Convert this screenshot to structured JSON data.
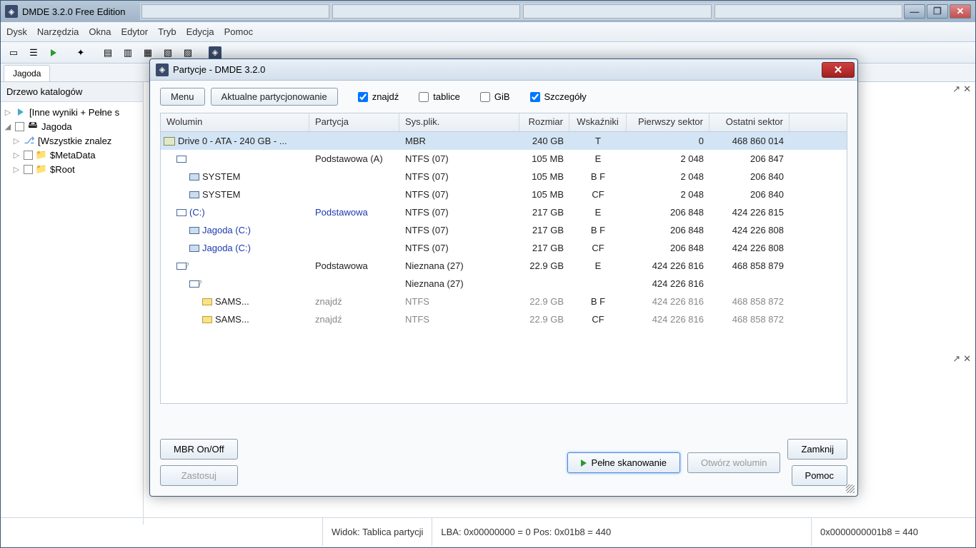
{
  "main_title": "DMDE 3.2.0 Free Edition",
  "menu": [
    "Dysk",
    "Narzędzia",
    "Okna",
    "Edytor",
    "Tryb",
    "Edycja",
    "Pomoc"
  ],
  "doc_tab": "Jagoda",
  "sidebar_title": "Drzewo katalogów",
  "tree": {
    "n0": "[Inne wyniki + Pełne s",
    "n1": "Jagoda",
    "n2": "[Wszystkie znalez",
    "n3": "$MetaData",
    "n4": "$Root"
  },
  "status": {
    "view": "Widok:  Tablica partycji",
    "lba": "LBA: 0x00000000 = 0  Pos: 0x01b8 = 440",
    "offs": "0x0000000001b8 = 440"
  },
  "dlg": {
    "title": "Partycje - DMDE 3.2.0",
    "btn_menu": "Menu",
    "btn_cur": "Aktualne partycjonowanie",
    "chk_find": "znajdź",
    "chk_tables": "tablice",
    "chk_gib": "GiB",
    "chk_details": "Szczegóły",
    "hdr": {
      "vol": "Wolumin",
      "part": "Partycja",
      "fs": "Sys.plik.",
      "size": "Rozmiar",
      "ind": "Wskaźniki",
      "first": "Pierwszy sektor",
      "last": "Ostatni sektor"
    },
    "rows": [
      {
        "vol": "Drive 0 - ATA - 240 GB - ...",
        "part": "",
        "fs": "MBR",
        "size": "240 GB",
        "ind": "T",
        "first": "0",
        "last": "468 860 014",
        "sel": true,
        "indent": 0,
        "ico": "drive",
        "green": true
      },
      {
        "vol": "",
        "part": "Podstawowa (A)",
        "fs": "NTFS (07)",
        "size": "105 MB",
        "ind": "E",
        "first": "2 048",
        "last": "206 847",
        "indent": 1,
        "ico": "vol"
      },
      {
        "vol": "SYSTEM",
        "part": "",
        "fs": "NTFS (07)",
        "size": "105 MB",
        "ind": "B  F",
        "first": "2 048",
        "last": "206 840",
        "indent": 2,
        "ico": "volblue",
        "green": true
      },
      {
        "vol": "SYSTEM",
        "part": "",
        "fs": "NTFS (07)",
        "size": "105 MB",
        "ind": "CF",
        "first": "2 048",
        "last": "206 840",
        "indent": 2,
        "ico": "volblue",
        "green": true
      },
      {
        "vol": "(C:)",
        "part": "Podstawowa",
        "fs": "NTFS (07)",
        "size": "217 GB",
        "ind": "E",
        "first": "206 848",
        "last": "424 226 815",
        "indent": 1,
        "ico": "vol",
        "link": true,
        "plink": true
      },
      {
        "vol": "Jagoda (C:)",
        "part": "",
        "fs": "NTFS (07)",
        "size": "217 GB",
        "ind": "B  F",
        "first": "206 848",
        "last": "424 226 808",
        "indent": 2,
        "ico": "volblue",
        "green": true,
        "link": true
      },
      {
        "vol": "Jagoda (C:)",
        "part": "",
        "fs": "NTFS (07)",
        "size": "217 GB",
        "ind": "CF",
        "first": "206 848",
        "last": "424 226 808",
        "indent": 2,
        "ico": "volblue",
        "green": true,
        "link": true
      },
      {
        "vol": "",
        "part": "Podstawowa",
        "fs": "Nieznana (27)",
        "size": "22.9 GB",
        "ind": "E",
        "first": "424 226 816",
        "last": "468 858 879",
        "indent": 1,
        "ico": "volq"
      },
      {
        "vol": "",
        "part": "",
        "fs": "Nieznana (27)",
        "size": "",
        "ind": "",
        "first": "424 226 816",
        "last": "",
        "indent": 2,
        "ico": "volq"
      },
      {
        "vol": "SAMS...",
        "part": "znajdź",
        "fs": "NTFS",
        "size": "22.9 GB",
        "ind": "B  F",
        "first": "424 226 816",
        "last": "468 858 872",
        "indent": 3,
        "ico": "voly",
        "green": true,
        "grey": true
      },
      {
        "vol": "SAMS...",
        "part": "znajdź",
        "fs": "NTFS",
        "size": "22.9 GB",
        "ind": "CF",
        "first": "424 226 816",
        "last": "468 858 872",
        "indent": 3,
        "ico": "voly",
        "green": true,
        "grey": true
      }
    ],
    "btn_mbr": "MBR On/Off",
    "btn_apply": "Zastosuj",
    "btn_scan": "Pełne skanowanie",
    "btn_open": "Otwórz wolumin",
    "btn_close": "Zamknij",
    "btn_help": "Pomoc"
  }
}
